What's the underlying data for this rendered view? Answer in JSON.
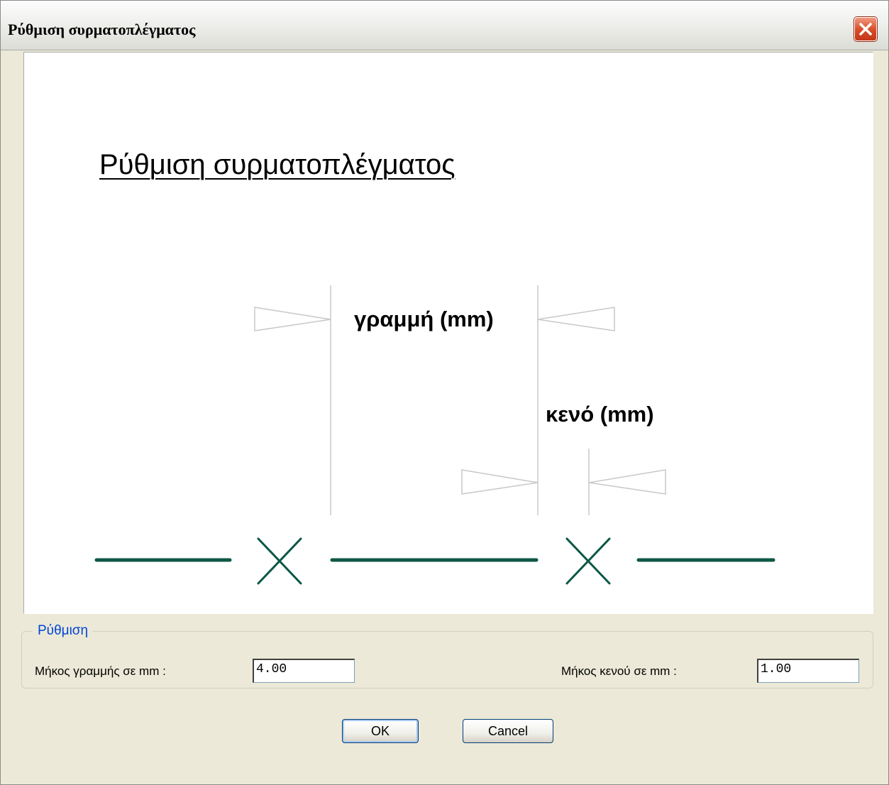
{
  "window": {
    "title": "Ρύθμιση συρματοπλέγματος",
    "close_icon": "close-icon"
  },
  "preview": {
    "heading": "Ρύθμιση συρματοπλέγματος",
    "line_label": "γραμμή (mm)",
    "gap_label": "κενό (mm)",
    "line_color": "#0b5745",
    "dim_color": "#c8c8c8"
  },
  "settings": {
    "group_label": "Ρύθμιση",
    "line_length_label": "Μήκος γραμμής σε mm :",
    "line_length_value": "4.00",
    "gap_length_label": "Μήκος κενού σε mm :",
    "gap_length_value": "1.00"
  },
  "buttons": {
    "ok": "OK",
    "cancel": "Cancel"
  }
}
